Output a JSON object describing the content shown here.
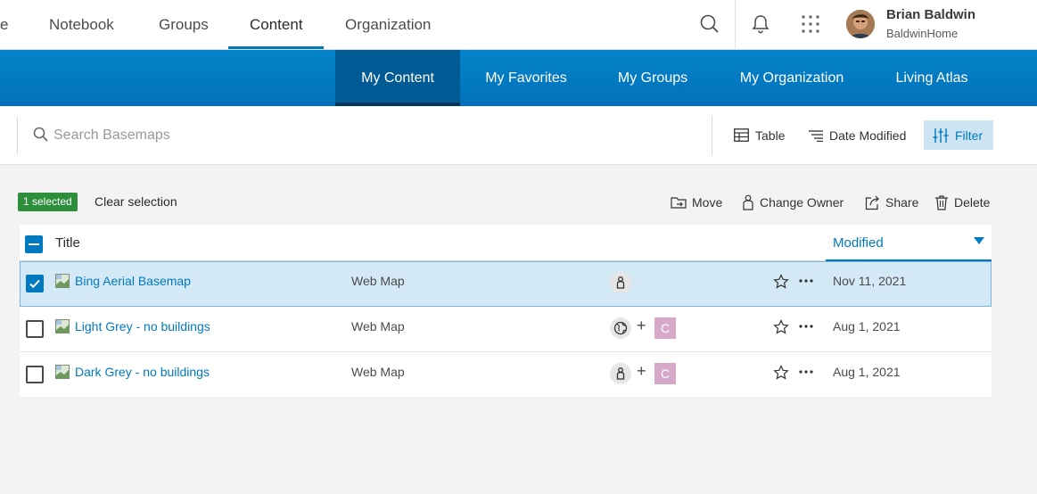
{
  "header": {
    "nav": [
      {
        "label": "e"
      },
      {
        "label": "Notebook"
      },
      {
        "label": "Groups"
      },
      {
        "label": "Content"
      },
      {
        "label": "Organization"
      }
    ],
    "active_nav": "Content",
    "user": {
      "name": "Brian Baldwin",
      "org": "BaldwinHome"
    },
    "icons": [
      "search-icon",
      "bell-icon",
      "apps-grid-icon"
    ]
  },
  "subnav": {
    "tabs": [
      {
        "label": "My Content"
      },
      {
        "label": "My Favorites"
      },
      {
        "label": "My Groups"
      },
      {
        "label": "My Organization"
      },
      {
        "label": "Living Atlas"
      }
    ],
    "active_tab": "My Content"
  },
  "search": {
    "placeholder": "Search Basemaps",
    "value": ""
  },
  "view_controls": {
    "table_label": "Table",
    "sort_label": "Date Modified",
    "filter_label": "Filter"
  },
  "selection": {
    "badge": "1 selected",
    "clear_label": "Clear selection",
    "actions": [
      {
        "label": "Move",
        "icon": "move-icon"
      },
      {
        "label": "Change Owner",
        "icon": "owner-icon"
      },
      {
        "label": "Share",
        "icon": "share-icon"
      },
      {
        "label": "Delete",
        "icon": "trash-icon"
      }
    ]
  },
  "table": {
    "columns": {
      "title": "Title",
      "modified": "Modified"
    },
    "rows": [
      {
        "title": "Bing Aerial Basemap",
        "type": "Web Map",
        "sharing": "private",
        "collab": "",
        "date": "Nov 11, 2021",
        "selected": true
      },
      {
        "title": "Light Grey - no buildings",
        "type": "Web Map",
        "sharing": "public",
        "plus": "+",
        "collab": "C",
        "date": "Aug 1, 2021",
        "selected": false
      },
      {
        "title": "Dark Grey - no buildings",
        "type": "Web Map",
        "sharing": "private",
        "plus": "+",
        "collab": "C",
        "date": "Aug 1, 2021",
        "selected": false
      }
    ]
  },
  "colors": {
    "accent": "#0079c1",
    "subnav_bg": "#0079c1",
    "badge_bg": "#2d8f3c",
    "collab_bg": "#d7a9c9"
  }
}
